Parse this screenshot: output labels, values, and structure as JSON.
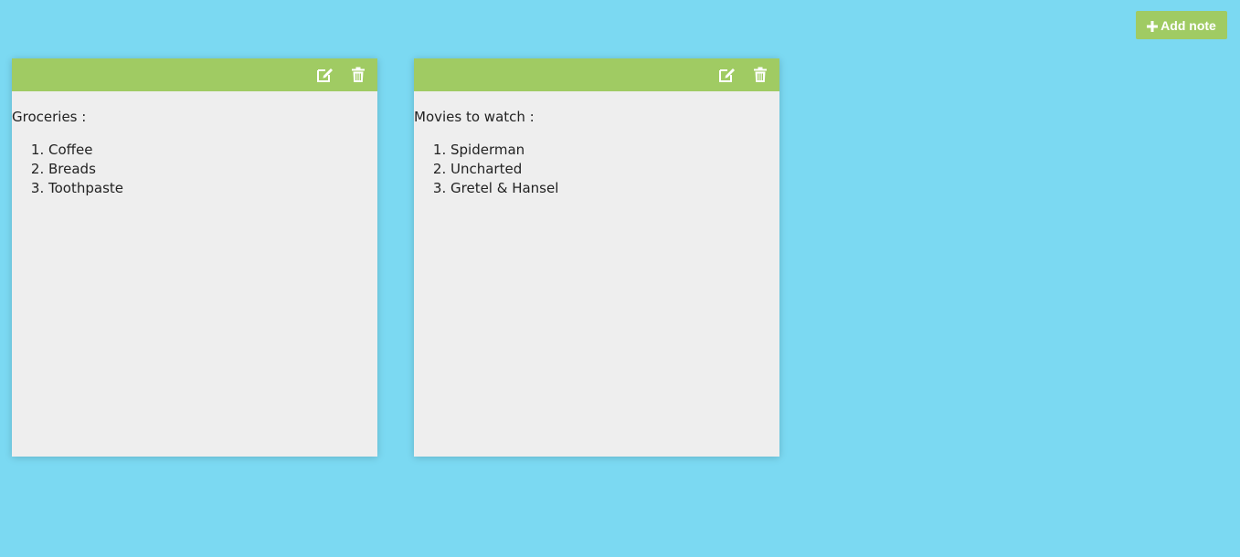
{
  "toolbar": {
    "add_note_label": "Add note",
    "add_note_icon": "plus-icon"
  },
  "colors": {
    "background": "#7bd9f2",
    "note_header": "#a0cb63",
    "note_body": "#eeeeee",
    "button": "#a0cb63"
  },
  "notes": [
    {
      "title": "Groceries :",
      "items": [
        "Coffee",
        "Breads",
        "Toothpaste"
      ],
      "actions": [
        "edit-icon",
        "trash-icon"
      ]
    },
    {
      "title": "Movies to watch :",
      "items": [
        "Spiderman",
        "Uncharted",
        "Gretel & Hansel"
      ],
      "actions": [
        "edit-icon",
        "trash-icon"
      ]
    }
  ]
}
